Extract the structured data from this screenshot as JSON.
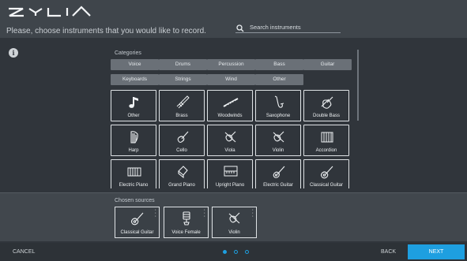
{
  "header": {
    "logo_text": "ZYLIA",
    "prompt": "Please, choose instruments that you would like to record.",
    "search": {
      "placeholder": "Search instruments",
      "value": ""
    }
  },
  "categories": {
    "label": "Categories",
    "items": [
      "Voice",
      "Drums",
      "Percussion",
      "Bass",
      "Guitar",
      "Keyboards",
      "Strings",
      "Wind",
      "Other"
    ]
  },
  "instruments": [
    {
      "label": "Other",
      "icon": "music-note-icon"
    },
    {
      "label": "Brass",
      "icon": "trumpet-icon"
    },
    {
      "label": "Woodwinds",
      "icon": "flute-icon"
    },
    {
      "label": "Saxophone",
      "icon": "saxophone-icon"
    },
    {
      "label": "Double Bass",
      "icon": "double-bass-icon"
    },
    {
      "label": "Harp",
      "icon": "harp-icon"
    },
    {
      "label": "Cello",
      "icon": "cello-icon"
    },
    {
      "label": "Viola",
      "icon": "viola-icon"
    },
    {
      "label": "Violin",
      "icon": "violin-icon"
    },
    {
      "label": "Accordion",
      "icon": "accordion-icon"
    },
    {
      "label": "Electric Piano",
      "icon": "electric-piano-icon"
    },
    {
      "label": "Grand Piano",
      "icon": "grand-piano-icon"
    },
    {
      "label": "Upright Piano",
      "icon": "upright-piano-icon"
    },
    {
      "label": "Electric Guitar",
      "icon": "electric-guitar-icon"
    },
    {
      "label": "Classical Guitar",
      "icon": "classical-guitar-icon"
    }
  ],
  "chosen": {
    "label": "Chosen sources",
    "items": [
      {
        "label": "Classical Guitar",
        "icon": "classical-guitar-icon"
      },
      {
        "label": "Voice Female",
        "icon": "microphone-icon"
      },
      {
        "label": "Violin",
        "icon": "violin-icon"
      }
    ]
  },
  "footer": {
    "cancel": "CANCEL",
    "back": "BACK",
    "next": "NEXT",
    "step_count": 3,
    "active_step": 1
  },
  "colors": {
    "accent": "#1e9fe0",
    "background": "#30353b",
    "header": "#3f454b",
    "category_button": "#6a7077"
  }
}
